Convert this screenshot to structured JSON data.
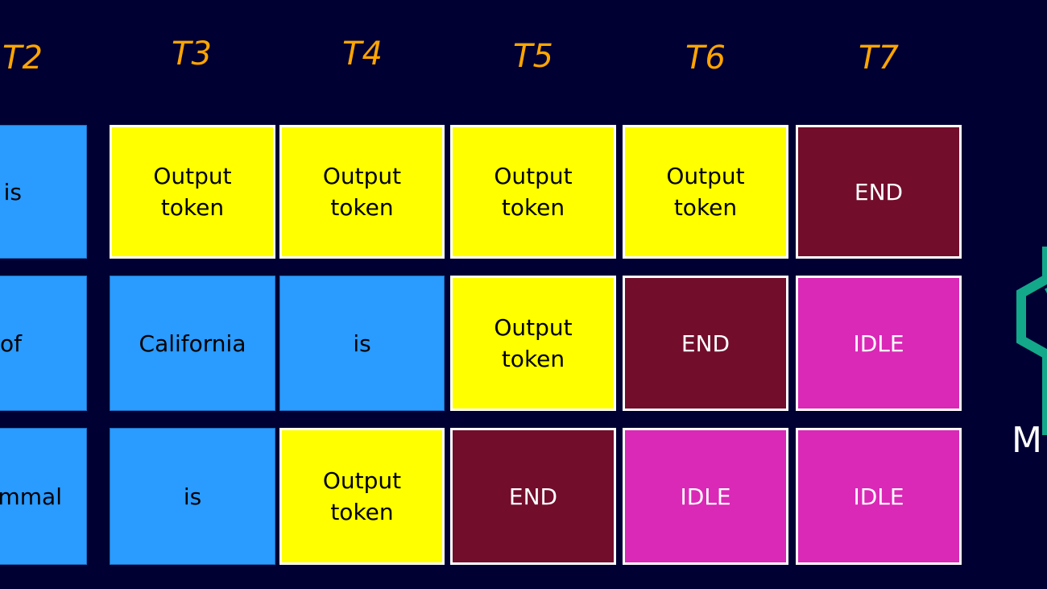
{
  "diagram": {
    "timesteps": [
      "T2",
      "T3",
      "T4",
      "T5",
      "T6",
      "T7"
    ],
    "legend_colors": {
      "input": "#2A9BFF",
      "output": "#FFFF00",
      "end": "#720D2C",
      "idle": "#DA28B7",
      "timestep_label": "#FFA500",
      "background": "#000033"
    },
    "rows": [
      {
        "name": "sequence-1",
        "cells": [
          {
            "type": "input",
            "text": "is"
          },
          {
            "type": "output",
            "text": "Output\ntoken"
          },
          {
            "type": "output",
            "text": "Output\ntoken"
          },
          {
            "type": "output",
            "text": "Output\ntoken"
          },
          {
            "type": "output",
            "text": "Output\ntoken"
          },
          {
            "type": "end",
            "text": "END"
          }
        ]
      },
      {
        "name": "sequence-2",
        "cells": [
          {
            "type": "input",
            "text": "of"
          },
          {
            "type": "input",
            "text": "California"
          },
          {
            "type": "input",
            "text": "is"
          },
          {
            "type": "output",
            "text": "Output\ntoken"
          },
          {
            "type": "end",
            "text": "END"
          },
          {
            "type": "idle",
            "text": "IDLE"
          }
        ]
      },
      {
        "name": "sequence-3",
        "cells": [
          {
            "type": "input",
            "text": "mmal"
          },
          {
            "type": "input",
            "text": "is"
          },
          {
            "type": "output",
            "text": "Output\ntoken"
          },
          {
            "type": "end",
            "text": "END"
          },
          {
            "type": "idle",
            "text": "IDLE"
          },
          {
            "type": "idle",
            "text": "IDLE"
          }
        ]
      }
    ],
    "logo": {
      "icon": "model-server-hexagon-icon",
      "color": "#13A88A",
      "text_partial": "M"
    }
  }
}
